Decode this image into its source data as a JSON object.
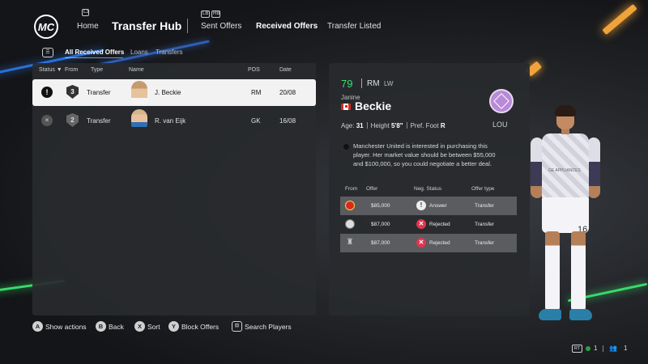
{
  "nav": {
    "logo_text": "MC",
    "home": "Home",
    "title": "Transfer Hub",
    "tabs": [
      "Sent Offers",
      "Received Offers",
      "Transfer Listed"
    ],
    "home_hint": "L3",
    "lb_hint": "LB",
    "rb_hint": "RB"
  },
  "subfilter": {
    "items": [
      "All Received Offers",
      "Loans",
      "Transfers"
    ],
    "selected": "All Received Offers"
  },
  "list": {
    "headers": {
      "status": "Status ▼",
      "from": "From",
      "type": "Type",
      "name": "Name",
      "pos": "POS",
      "date": "Date"
    },
    "rows": [
      {
        "status_icon": "!",
        "from_count": "3",
        "type": "Transfer",
        "name": "J. Beckie",
        "pos": "RM",
        "date": "20/08",
        "selected": true
      },
      {
        "status_icon": "×",
        "from_count": "2",
        "type": "Transfer",
        "name": "R. van Eijk",
        "pos": "GK",
        "date": "16/08",
        "selected": false
      }
    ]
  },
  "player": {
    "overall": "79",
    "primary_pos": "RM",
    "alt_pos": "LW",
    "first_name": "Janine",
    "last_name": "Beckie",
    "nationality_flag": "flag-canada-icon",
    "club_code": "LOU",
    "age_label": "Age:",
    "age": "31",
    "height_label": "Height",
    "height": "5'8\"",
    "foot_label": "Pref. Foot",
    "foot": "R",
    "message": "Manchester United is interested in purchasing this player. Her market value should be between $55,000 and $100,000, so you could negotiate a better deal."
  },
  "offers": {
    "headers": {
      "from": "From",
      "offer": "Offer",
      "neg_status": "Neg. Status",
      "offer_type": "Offer type"
    },
    "rows": [
      {
        "club_icon": "manchester-united-crest-icon",
        "offer": "$85,000",
        "status_icon": "!",
        "status": "Answer",
        "type": "Transfer"
      },
      {
        "club_icon": "white-crest-icon",
        "offer": "$87,000",
        "status_icon": "✕",
        "status": "Rejected",
        "type": "Transfer"
      },
      {
        "club_icon": "liverpool-crest-icon",
        "offer": "$87,000",
        "status_icon": "✕",
        "status": "Rejected",
        "type": "Transfer"
      }
    ]
  },
  "model": {
    "shirt_number": "16",
    "sponsor": "GE APPLIANCES"
  },
  "hints": [
    {
      "button": "A",
      "label": "Show actions"
    },
    {
      "button": "B",
      "label": "Back"
    },
    {
      "button": "X",
      "label": "Sort"
    },
    {
      "button": "Y",
      "label": "Block Offers"
    },
    {
      "button": "⊡",
      "label": "Search Players"
    }
  ],
  "status_bar": {
    "rt": "RT",
    "count1": "1",
    "count2": "1"
  },
  "colors": {
    "accent_green": "#3ddc6f",
    "rejected_red": "#e3344d",
    "panel": "#282a2e"
  }
}
